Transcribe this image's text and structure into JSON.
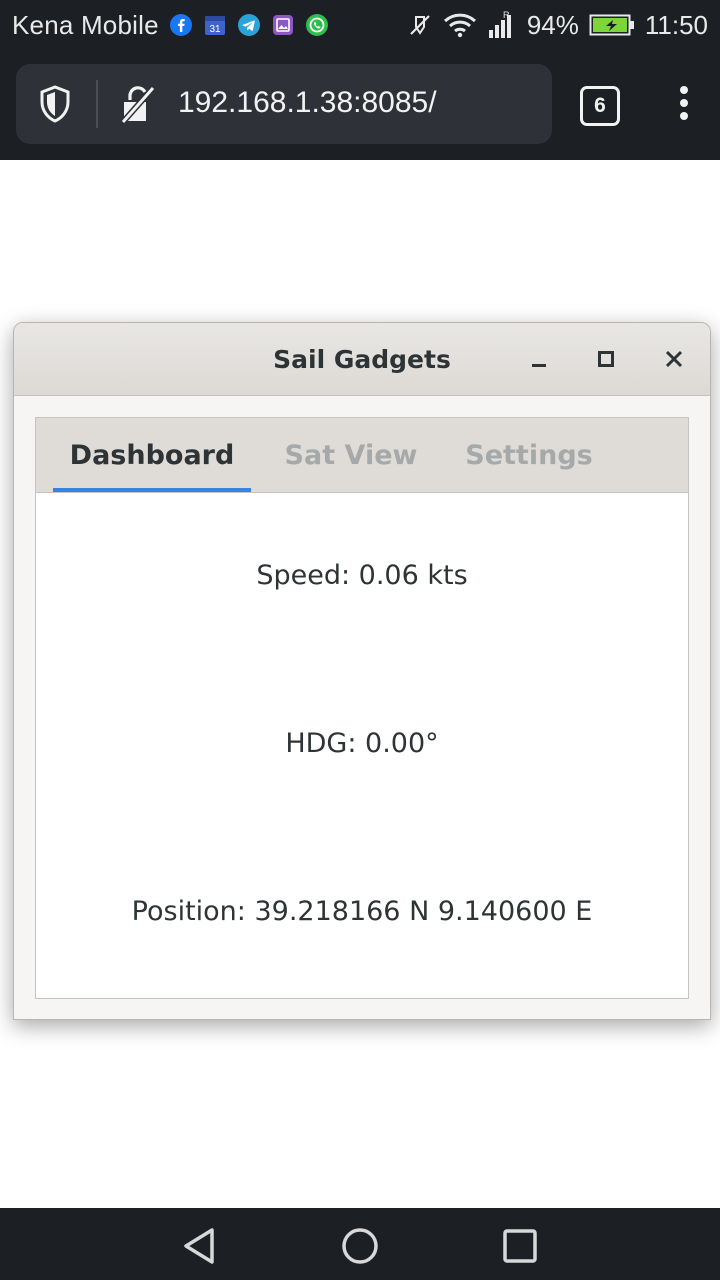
{
  "status_bar": {
    "carrier": "Kena Mobile",
    "battery": "94%",
    "time": "11:50",
    "notification_icons": [
      "facebook-icon",
      "calendar-icon",
      "telegram-icon",
      "gallery-icon",
      "whatsapp-icon"
    ],
    "calendar_day": "31",
    "roaming_marker": "R"
  },
  "browser": {
    "url": "192.168.1.38:8085/",
    "tab_count": "6"
  },
  "window": {
    "title": "Sail Gadgets",
    "tabs": [
      {
        "label": "Dashboard",
        "active": true
      },
      {
        "label": "Sat View",
        "active": false
      },
      {
        "label": "Settings",
        "active": false
      }
    ],
    "dashboard": {
      "speed": "Speed: 0.06 kts",
      "heading": "HDG: 0.00°",
      "position": "Position: 39.218166 N 9.140600 E"
    }
  },
  "colors": {
    "system_bar": "#1c1f24",
    "url_field": "#2e3238",
    "accent": "#3584e4",
    "battery": "#7bd63a"
  }
}
